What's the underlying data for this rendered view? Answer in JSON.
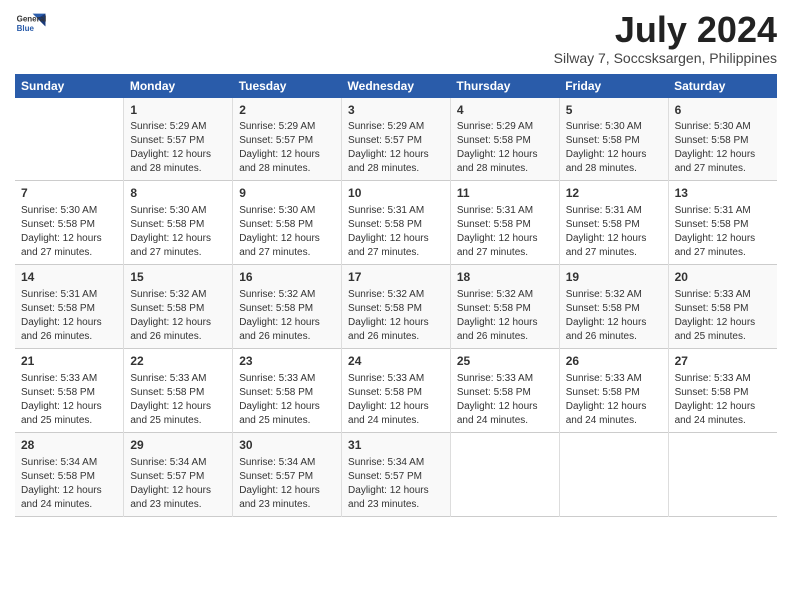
{
  "header": {
    "logo_line1": "General",
    "logo_line2": "Blue",
    "month_year": "July 2024",
    "location": "Silway 7, Soccsksargen, Philippines"
  },
  "days_of_week": [
    "Sunday",
    "Monday",
    "Tuesday",
    "Wednesday",
    "Thursday",
    "Friday",
    "Saturday"
  ],
  "weeks": [
    [
      {
        "day": "",
        "info": ""
      },
      {
        "day": "1",
        "info": "Sunrise: 5:29 AM\nSunset: 5:57 PM\nDaylight: 12 hours and 28 minutes."
      },
      {
        "day": "2",
        "info": "Sunrise: 5:29 AM\nSunset: 5:57 PM\nDaylight: 12 hours and 28 minutes."
      },
      {
        "day": "3",
        "info": "Sunrise: 5:29 AM\nSunset: 5:57 PM\nDaylight: 12 hours and 28 minutes."
      },
      {
        "day": "4",
        "info": "Sunrise: 5:29 AM\nSunset: 5:58 PM\nDaylight: 12 hours and 28 minutes."
      },
      {
        "day": "5",
        "info": "Sunrise: 5:30 AM\nSunset: 5:58 PM\nDaylight: 12 hours and 28 minutes."
      },
      {
        "day": "6",
        "info": "Sunrise: 5:30 AM\nSunset: 5:58 PM\nDaylight: 12 hours and 27 minutes."
      }
    ],
    [
      {
        "day": "7",
        "info": "Sunrise: 5:30 AM\nSunset: 5:58 PM\nDaylight: 12 hours and 27 minutes."
      },
      {
        "day": "8",
        "info": "Sunrise: 5:30 AM\nSunset: 5:58 PM\nDaylight: 12 hours and 27 minutes."
      },
      {
        "day": "9",
        "info": "Sunrise: 5:30 AM\nSunset: 5:58 PM\nDaylight: 12 hours and 27 minutes."
      },
      {
        "day": "10",
        "info": "Sunrise: 5:31 AM\nSunset: 5:58 PM\nDaylight: 12 hours and 27 minutes."
      },
      {
        "day": "11",
        "info": "Sunrise: 5:31 AM\nSunset: 5:58 PM\nDaylight: 12 hours and 27 minutes."
      },
      {
        "day": "12",
        "info": "Sunrise: 5:31 AM\nSunset: 5:58 PM\nDaylight: 12 hours and 27 minutes."
      },
      {
        "day": "13",
        "info": "Sunrise: 5:31 AM\nSunset: 5:58 PM\nDaylight: 12 hours and 27 minutes."
      }
    ],
    [
      {
        "day": "14",
        "info": "Sunrise: 5:31 AM\nSunset: 5:58 PM\nDaylight: 12 hours and 26 minutes."
      },
      {
        "day": "15",
        "info": "Sunrise: 5:32 AM\nSunset: 5:58 PM\nDaylight: 12 hours and 26 minutes."
      },
      {
        "day": "16",
        "info": "Sunrise: 5:32 AM\nSunset: 5:58 PM\nDaylight: 12 hours and 26 minutes."
      },
      {
        "day": "17",
        "info": "Sunrise: 5:32 AM\nSunset: 5:58 PM\nDaylight: 12 hours and 26 minutes."
      },
      {
        "day": "18",
        "info": "Sunrise: 5:32 AM\nSunset: 5:58 PM\nDaylight: 12 hours and 26 minutes."
      },
      {
        "day": "19",
        "info": "Sunrise: 5:32 AM\nSunset: 5:58 PM\nDaylight: 12 hours and 26 minutes."
      },
      {
        "day": "20",
        "info": "Sunrise: 5:33 AM\nSunset: 5:58 PM\nDaylight: 12 hours and 25 minutes."
      }
    ],
    [
      {
        "day": "21",
        "info": "Sunrise: 5:33 AM\nSunset: 5:58 PM\nDaylight: 12 hours and 25 minutes."
      },
      {
        "day": "22",
        "info": "Sunrise: 5:33 AM\nSunset: 5:58 PM\nDaylight: 12 hours and 25 minutes."
      },
      {
        "day": "23",
        "info": "Sunrise: 5:33 AM\nSunset: 5:58 PM\nDaylight: 12 hours and 25 minutes."
      },
      {
        "day": "24",
        "info": "Sunrise: 5:33 AM\nSunset: 5:58 PM\nDaylight: 12 hours and 24 minutes."
      },
      {
        "day": "25",
        "info": "Sunrise: 5:33 AM\nSunset: 5:58 PM\nDaylight: 12 hours and 24 minutes."
      },
      {
        "day": "26",
        "info": "Sunrise: 5:33 AM\nSunset: 5:58 PM\nDaylight: 12 hours and 24 minutes."
      },
      {
        "day": "27",
        "info": "Sunrise: 5:33 AM\nSunset: 5:58 PM\nDaylight: 12 hours and 24 minutes."
      }
    ],
    [
      {
        "day": "28",
        "info": "Sunrise: 5:34 AM\nSunset: 5:58 PM\nDaylight: 12 hours and 24 minutes."
      },
      {
        "day": "29",
        "info": "Sunrise: 5:34 AM\nSunset: 5:57 PM\nDaylight: 12 hours and 23 minutes."
      },
      {
        "day": "30",
        "info": "Sunrise: 5:34 AM\nSunset: 5:57 PM\nDaylight: 12 hours and 23 minutes."
      },
      {
        "day": "31",
        "info": "Sunrise: 5:34 AM\nSunset: 5:57 PM\nDaylight: 12 hours and 23 minutes."
      },
      {
        "day": "",
        "info": ""
      },
      {
        "day": "",
        "info": ""
      },
      {
        "day": "",
        "info": ""
      }
    ]
  ]
}
